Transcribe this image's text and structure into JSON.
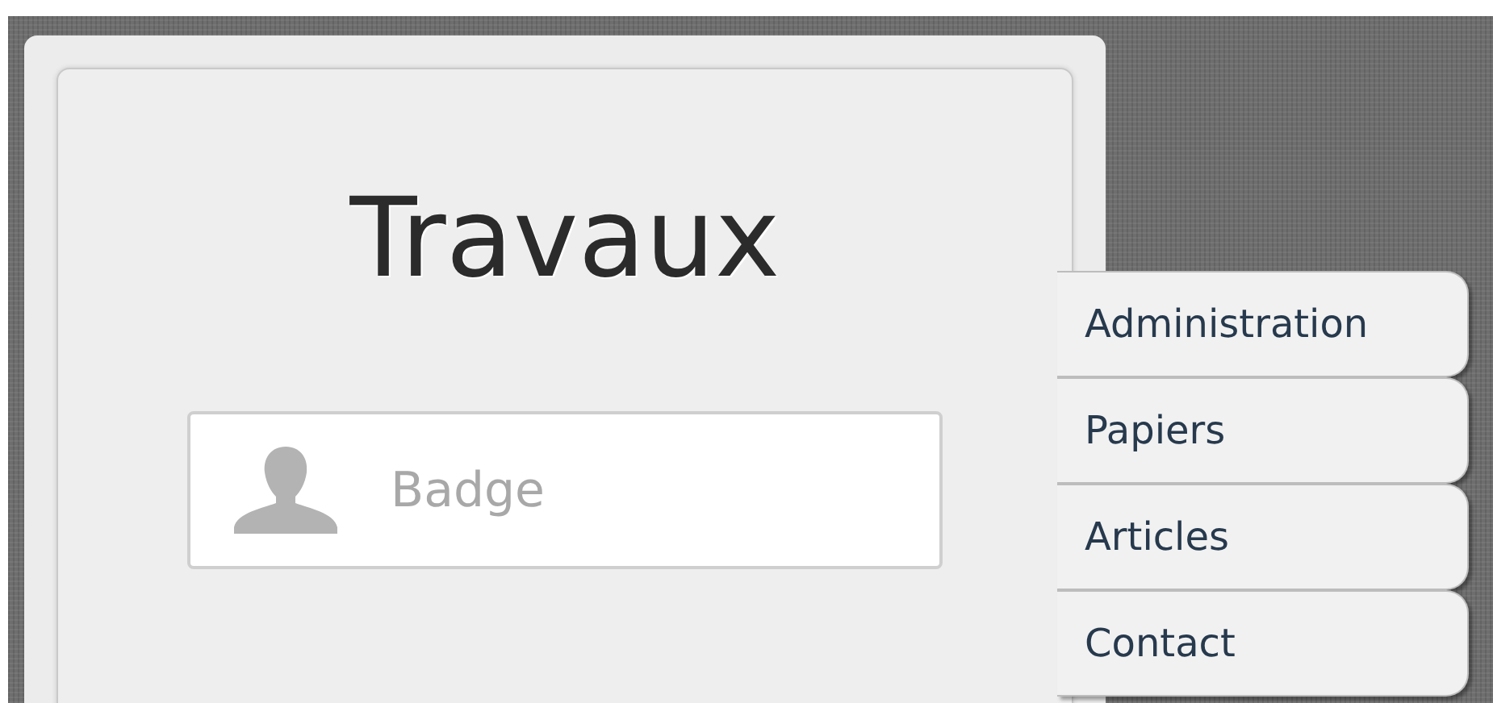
{
  "title": "Travaux",
  "badge_field": {
    "placeholder": "Badge"
  },
  "tabs": [
    {
      "label": "Administration"
    },
    {
      "label": "Papiers"
    },
    {
      "label": "Articles"
    },
    {
      "label": "Contact"
    }
  ]
}
